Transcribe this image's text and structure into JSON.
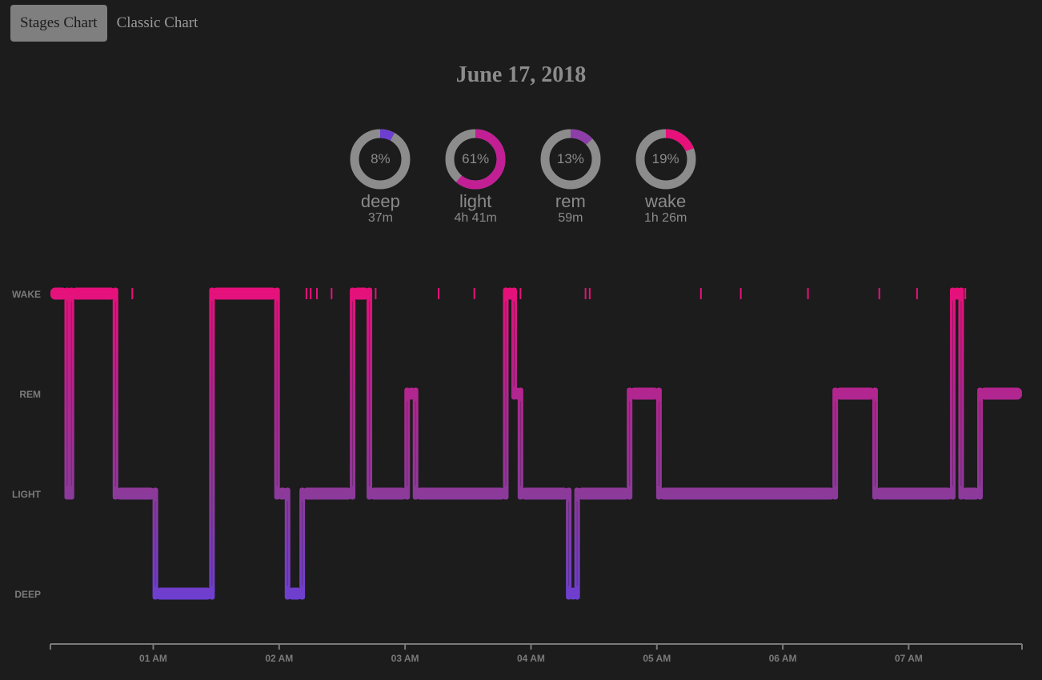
{
  "tabs": {
    "stages": "Stages Chart",
    "classic": "Classic Chart"
  },
  "title": "June 17, 2018",
  "summary": [
    {
      "key": "deep",
      "pct_label": "8%",
      "pct": 8,
      "label": "deep",
      "duration": "37m",
      "color": "#6d3fd0"
    },
    {
      "key": "light",
      "pct_label": "61%",
      "pct": 61,
      "label": "light",
      "duration": "4h 41m",
      "color": "#c21f95"
    },
    {
      "key": "rem",
      "pct_label": "13%",
      "pct": 13,
      "label": "rem",
      "duration": "59m",
      "color": "#8e3ea8"
    },
    {
      "key": "wake",
      "pct_label": "19%",
      "pct": 19,
      "label": "wake",
      "duration": "1h 26m",
      "color": "#e8107a"
    }
  ],
  "colors": {
    "background": "#1c1c1c",
    "wake": "#e8107a",
    "rem": "#b3258f",
    "light": "#8c3a9a",
    "deep": "#6d3fd0",
    "ring_track": "#8c8c8c"
  },
  "chart_data": {
    "type": "hypnogram",
    "levels": [
      "WAKE",
      "REM",
      "LIGHT",
      "DEEP"
    ],
    "x_range": [
      "00:11",
      "07:54"
    ],
    "x_ticks": [
      "01 AM",
      "02 AM",
      "03 AM",
      "04 AM",
      "05 AM",
      "06 AM",
      "07 AM"
    ],
    "segments": [
      {
        "start": "00:11",
        "end": "00:19",
        "stage": "WAKE"
      },
      {
        "start": "00:19",
        "end": "00:21",
        "stage": "LIGHT"
      },
      {
        "start": "00:21",
        "end": "00:42",
        "stage": "WAKE"
      },
      {
        "start": "00:42",
        "end": "01:01",
        "stage": "LIGHT"
      },
      {
        "start": "01:01",
        "end": "01:28",
        "stage": "DEEP"
      },
      {
        "start": "01:28",
        "end": "01:59",
        "stage": "WAKE"
      },
      {
        "start": "01:59",
        "end": "02:04",
        "stage": "LIGHT"
      },
      {
        "start": "02:04",
        "end": "02:11",
        "stage": "DEEP"
      },
      {
        "start": "02:11",
        "end": "02:35",
        "stage": "LIGHT"
      },
      {
        "start": "02:35",
        "end": "02:43",
        "stage": "WAKE"
      },
      {
        "start": "02:43",
        "end": "03:01",
        "stage": "LIGHT"
      },
      {
        "start": "03:01",
        "end": "03:05",
        "stage": "REM"
      },
      {
        "start": "03:05",
        "end": "03:48",
        "stage": "LIGHT"
      },
      {
        "start": "03:48",
        "end": "03:52",
        "stage": "WAKE"
      },
      {
        "start": "03:52",
        "end": "03:55",
        "stage": "REM"
      },
      {
        "start": "03:55",
        "end": "04:18",
        "stage": "LIGHT"
      },
      {
        "start": "04:18",
        "end": "04:22",
        "stage": "DEEP"
      },
      {
        "start": "04:22",
        "end": "04:47",
        "stage": "LIGHT"
      },
      {
        "start": "04:47",
        "end": "05:01",
        "stage": "REM"
      },
      {
        "start": "05:01",
        "end": "06:25",
        "stage": "LIGHT"
      },
      {
        "start": "06:25",
        "end": "06:44",
        "stage": "REM"
      },
      {
        "start": "06:44",
        "end": "07:21",
        "stage": "LIGHT"
      },
      {
        "start": "07:21",
        "end": "07:25",
        "stage": "WAKE"
      },
      {
        "start": "07:25",
        "end": "07:34",
        "stage": "LIGHT"
      },
      {
        "start": "07:34",
        "end": "07:54",
        "stage": "REM"
      }
    ],
    "short_wakes": [
      "00:50",
      "02:13",
      "02:15",
      "02:18",
      "02:25",
      "02:46",
      "03:16",
      "03:33",
      "03:55",
      "04:26",
      "04:28",
      "05:21",
      "05:40",
      "06:12",
      "06:46",
      "07:04",
      "07:27"
    ]
  }
}
